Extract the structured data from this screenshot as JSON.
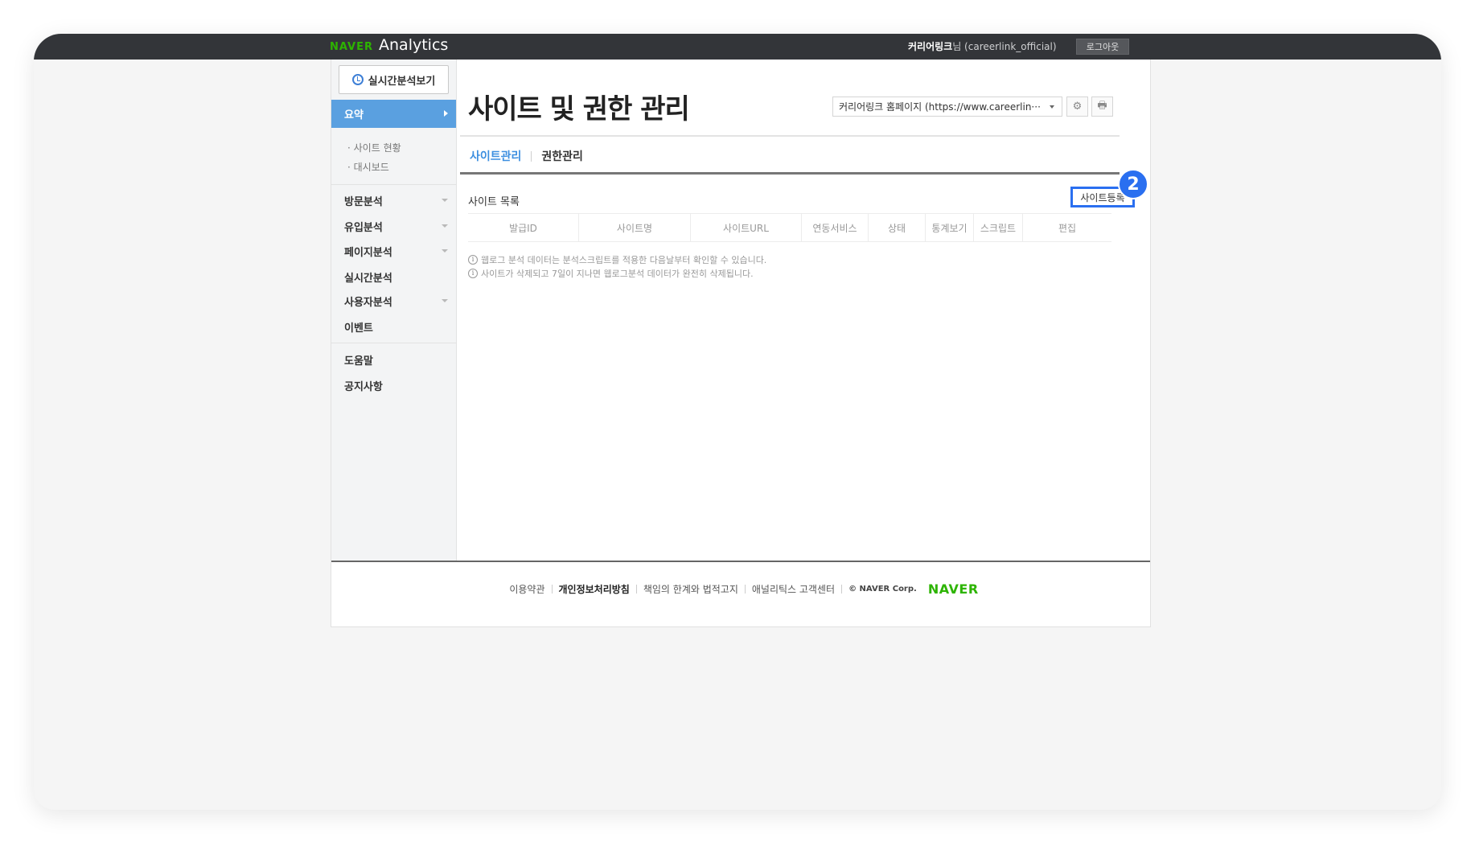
{
  "topbar": {
    "brand_naver": "NAVER",
    "brand_product": "Analytics",
    "user_name": "커리어링크",
    "user_suffix": "님 (careerlink_official)",
    "logout_label": "로그아웃"
  },
  "sidebar": {
    "realtime_button": "실시간분석보기",
    "active_item": "요약",
    "sub_items": [
      "· 사이트 현황",
      "· 대시보드"
    ],
    "items": [
      {
        "label": "방문분석",
        "has_dropdown": true
      },
      {
        "label": "유입분석",
        "has_dropdown": true
      },
      {
        "label": "페이지분석",
        "has_dropdown": true
      },
      {
        "label": "실시간분석",
        "has_dropdown": false
      },
      {
        "label": "사용자분석",
        "has_dropdown": true
      },
      {
        "label": "이벤트",
        "has_dropdown": false
      }
    ],
    "help": "도움말",
    "notice": "공지사항"
  },
  "main": {
    "title": "사이트 및 권한 관리",
    "site_selector": "커리어링크 홈페이지 (https://www.careerlin···",
    "settings_icon": "gear-icon",
    "print_icon": "print-icon",
    "tabs": [
      {
        "label": "사이트관리",
        "active": true
      },
      {
        "label": "권한관리",
        "active": false
      }
    ],
    "list_title": "사이트 목록",
    "register_button": "사이트등록",
    "step_badge": "2",
    "columns": [
      "발급ID",
      "사이트명",
      "사이트URL",
      "연동서비스",
      "상태",
      "통계보기",
      "스크립트",
      "편집"
    ],
    "notes": [
      "웹로그 분석 데이터는 분석스크립트를 적용한 다음날부터 확인할 수 있습니다.",
      "사이트가 삭제되고 7일이 지나면 웹로그분석 데이터가 완전히 삭제됩니다."
    ]
  },
  "footer": {
    "links": [
      {
        "label": "이용약관",
        "bold": false
      },
      {
        "label": "개인정보처리방침",
        "bold": true
      },
      {
        "label": "책임의 한계와 법적고지",
        "bold": false
      },
      {
        "label": "애널리틱스 고객센터",
        "bold": false
      }
    ],
    "copyright": "© NAVER Corp.",
    "logo": "NAVER"
  },
  "colors": {
    "topbar_bg": "#333539",
    "brand_green": "#2db400",
    "active_nav": "#5aa0e0",
    "active_tab": "#3d8fe0",
    "highlight_blue": "#2a6ff0"
  }
}
